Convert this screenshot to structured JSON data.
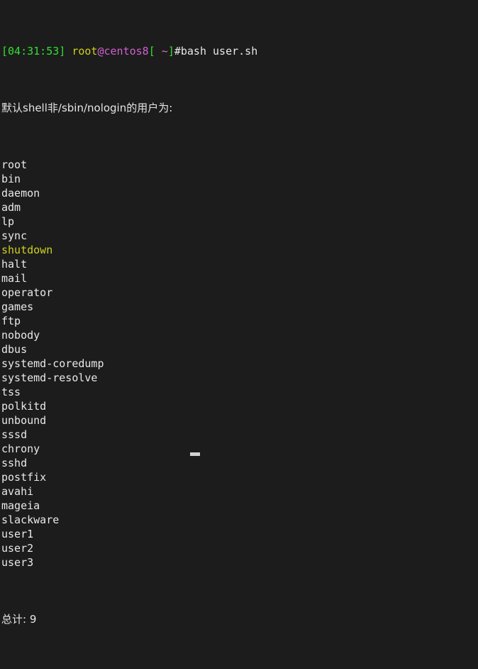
{
  "terminal": {
    "background_color": "#1c1c1c",
    "foreground_color": "#e5e5e5",
    "prompt": {
      "time_bracket_open": "[",
      "time": "04:31:53",
      "time_bracket_close": "]",
      "space_after_time": " ",
      "user": "root",
      "at": "@",
      "host": "centos8",
      "path_bracket_open": "[",
      "path": " ~",
      "path_bracket_close": "]",
      "hash": "#",
      "command": "bash user.sh",
      "colors": {
        "time": "#32e032",
        "user": "#d0d020",
        "at": "#d060d0",
        "host": "#d060d0",
        "brackets": "#32e032",
        "path": "#e070c0",
        "hash": "#e8e8e8",
        "command": "#e8e8e8"
      }
    },
    "output_header": "默认shell非/sbin/nologin的用户为:",
    "users": [
      {
        "name": "root",
        "color": "#e8e8e8"
      },
      {
        "name": "bin",
        "color": "#e8e8e8"
      },
      {
        "name": "daemon",
        "color": "#e8e8e8"
      },
      {
        "name": "adm",
        "color": "#e8e8e8"
      },
      {
        "name": "lp",
        "color": "#e8e8e8"
      },
      {
        "name": "sync",
        "color": "#e8e8e8"
      },
      {
        "name": "shutdown",
        "color": "#d0d020"
      },
      {
        "name": "halt",
        "color": "#e8e8e8"
      },
      {
        "name": "mail",
        "color": "#e8e8e8"
      },
      {
        "name": "operator",
        "color": "#e8e8e8"
      },
      {
        "name": "games",
        "color": "#e8e8e8"
      },
      {
        "name": "ftp",
        "color": "#e8e8e8"
      },
      {
        "name": "nobody",
        "color": "#e8e8e8"
      },
      {
        "name": "dbus",
        "color": "#e8e8e8"
      },
      {
        "name": "systemd-coredump",
        "color": "#e8e8e8"
      },
      {
        "name": "systemd-resolve",
        "color": "#e8e8e8"
      },
      {
        "name": "tss",
        "color": "#e8e8e8"
      },
      {
        "name": "polkitd",
        "color": "#e8e8e8"
      },
      {
        "name": "unbound",
        "color": "#e8e8e8"
      },
      {
        "name": "sssd",
        "color": "#e8e8e8"
      },
      {
        "name": "chrony",
        "color": "#e8e8e8"
      },
      {
        "name": "sshd",
        "color": "#e8e8e8"
      },
      {
        "name": "postfix",
        "color": "#e8e8e8"
      },
      {
        "name": "avahi",
        "color": "#e8e8e8"
      },
      {
        "name": "mageia",
        "color": "#e8e8e8"
      },
      {
        "name": "slackware",
        "color": "#e8e8e8"
      },
      {
        "name": "user1",
        "color": "#e8e8e8"
      },
      {
        "name": "user2",
        "color": "#e8e8e8"
      },
      {
        "name": "user3",
        "color": "#e8e8e8"
      }
    ],
    "total_line": "总计: 9"
  }
}
